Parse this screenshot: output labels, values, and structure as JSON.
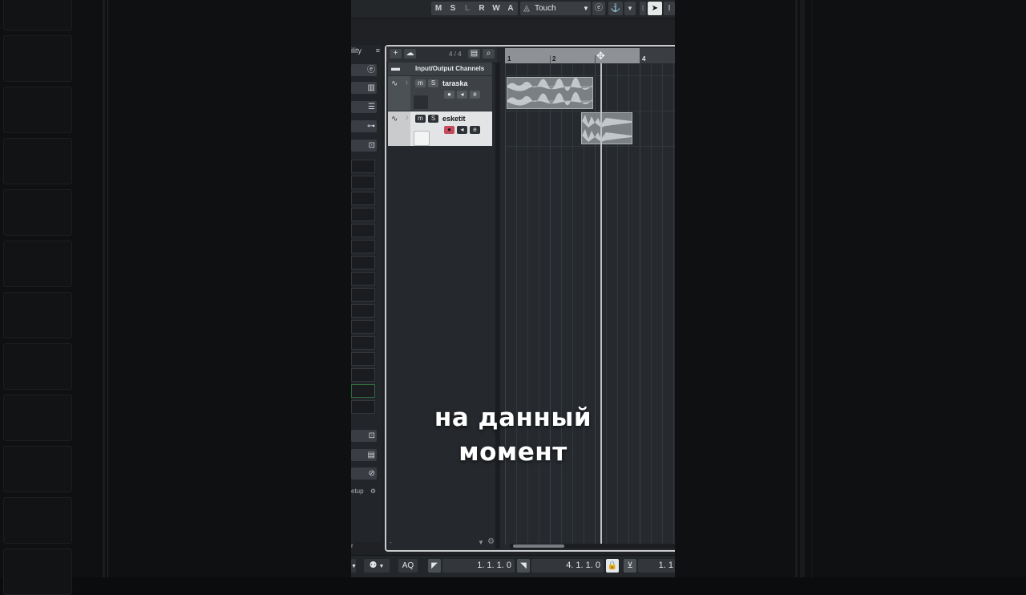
{
  "toolbar": {
    "mslrwa": [
      "M",
      "S",
      "L",
      "R",
      "W",
      "A"
    ],
    "automation_mode": "Touch"
  },
  "inspector": {
    "header_label": "ility",
    "setup_label": "etup",
    "bottom_label": "r"
  },
  "project": {
    "track_count": "4 / 4",
    "ruler_numbers": [
      "1",
      "2",
      "4"
    ],
    "folder_track": {
      "name": "Input/Output Channels"
    },
    "tracks": [
      {
        "number": "1",
        "name": "taraska",
        "selected": false
      },
      {
        "number": "2",
        "name": "esketit",
        "selected": true
      }
    ],
    "bottom_dash": "-"
  },
  "transport": {
    "aq_label": "AQ",
    "left_locator": "1. 1. 1.   0",
    "right_locator": "4. 1. 1.   0",
    "position": "1. 1"
  },
  "caption": {
    "line1": "на данный",
    "line2": "момент"
  },
  "colors": {
    "record_active": "#c84a5e",
    "cycle_region": "#8e9296",
    "selected_track": "#e3e4e5"
  }
}
